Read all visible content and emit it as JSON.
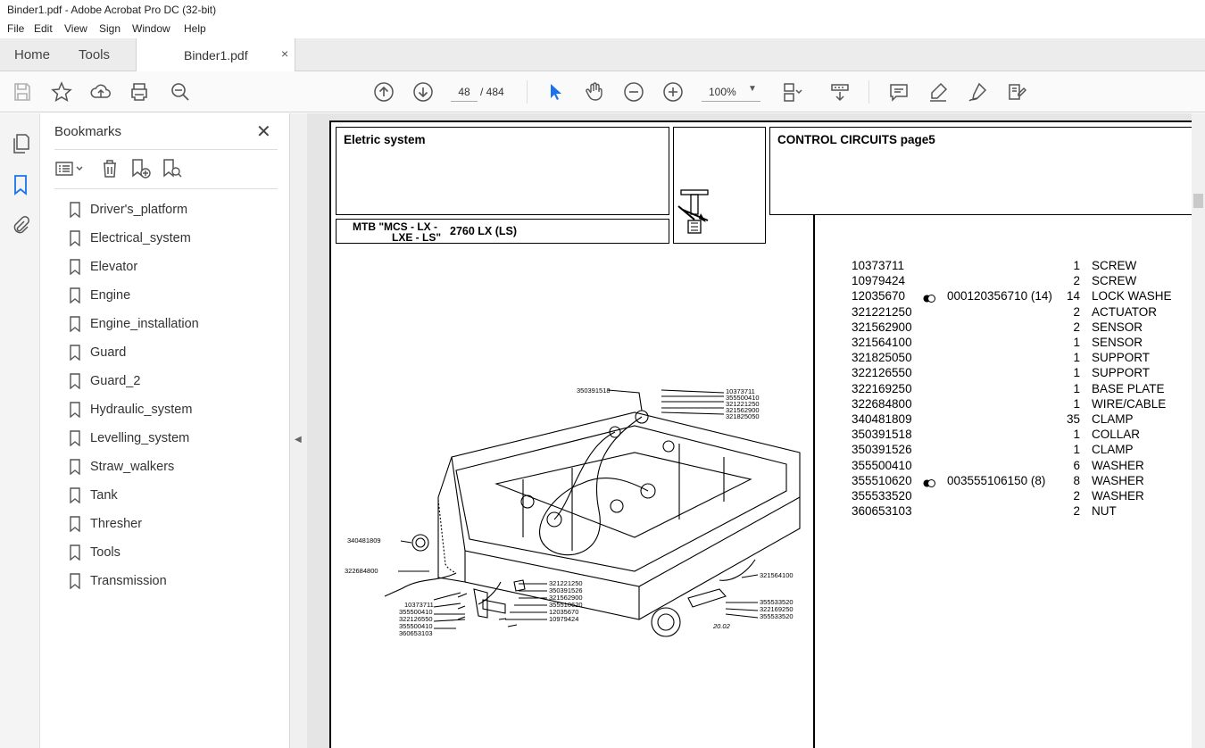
{
  "window": {
    "title": "Binder1.pdf - Adobe Acrobat Pro DC (32-bit)"
  },
  "menu": [
    "File",
    "Edit",
    "View",
    "Sign",
    "Window",
    "Help"
  ],
  "tabs": {
    "home": "Home",
    "tools": "Tools",
    "document": "Binder1.pdf",
    "close": "×"
  },
  "toolbar": {
    "current_page": "48",
    "page_total": "/ 484",
    "zoom": "100%",
    "icons": [
      "save-icon",
      "star-icon",
      "upload-icon",
      "print-icon",
      "zoom-search-icon",
      "arrow-up-icon",
      "arrow-down-icon",
      "select-cursor-icon",
      "hand-icon",
      "zoom-out-icon",
      "zoom-in-icon",
      "page-layout-icon",
      "scroll-mode-icon",
      "comment-icon",
      "highlight-icon",
      "draw-icon",
      "fill-sign-icon"
    ]
  },
  "bookmarks": {
    "title": "Bookmarks",
    "close": "✕",
    "items": [
      "Driver's_platform",
      "Electrical_system",
      "Elevator",
      "Engine",
      "Engine_installation",
      "Guard",
      "Guard_2",
      "Hydraulic_system",
      "Levelling_system",
      "Straw_walkers",
      "Tank",
      "Thresher",
      "Tools",
      "Transmission"
    ]
  },
  "document": {
    "section_title": "Eletric system",
    "model_line1": "MTB \"MCS - LX -",
    "model_line2": "LXE - LS\"",
    "model_code": "2760 LX (LS)",
    "page_title": "CONTROL CIRCUITS  page5",
    "parts": [
      {
        "code": "10373711",
        "alt": "",
        "qty": "1",
        "desc": "SCREW"
      },
      {
        "code": "10979424",
        "alt": "",
        "qty": "2",
        "desc": "SCREW"
      },
      {
        "code": "12035670",
        "alt": "000120356710  (14)",
        "qty": "14",
        "desc": "LOCK WASHE"
      },
      {
        "code": "321221250",
        "alt": "",
        "qty": "2",
        "desc": "ACTUATOR"
      },
      {
        "code": "321562900",
        "alt": "",
        "qty": "2",
        "desc": "SENSOR"
      },
      {
        "code": "321564100",
        "alt": "",
        "qty": "1",
        "desc": "SENSOR"
      },
      {
        "code": "321825050",
        "alt": "",
        "qty": "1",
        "desc": "SUPPORT"
      },
      {
        "code": "322126550",
        "alt": "",
        "qty": "1",
        "desc": "SUPPORT"
      },
      {
        "code": "322169250",
        "alt": "",
        "qty": "1",
        "desc": "BASE PLATE"
      },
      {
        "code": "322684800",
        "alt": "",
        "qty": "1",
        "desc": "WIRE/CABLE"
      },
      {
        "code": "340481809",
        "alt": "",
        "qty": "35",
        "desc": "CLAMP"
      },
      {
        "code": "350391518",
        "alt": "",
        "qty": "1",
        "desc": "COLLAR"
      },
      {
        "code": "350391526",
        "alt": "",
        "qty": "1",
        "desc": "CLAMP"
      },
      {
        "code": "355500410",
        "alt": "",
        "qty": "6",
        "desc": "WASHER"
      },
      {
        "code": "355510620",
        "alt": "003555106150  (8)",
        "qty": "8",
        "desc": "WASHER"
      },
      {
        "code": "355533520",
        "alt": "",
        "qty": "2",
        "desc": "WASHER"
      },
      {
        "code": "360653103",
        "alt": "",
        "qty": "2",
        "desc": "NUT"
      }
    ],
    "diagram_labels": {
      "top_left": "350391518",
      "top_right": [
        "10373711",
        "355500410",
        "321221250",
        "321562900",
        "321825050"
      ],
      "left": [
        "340481809",
        "322684800"
      ],
      "bottom_left": [
        "10373711",
        "355500410",
        "322126550",
        "355500410",
        "360653103"
      ],
      "bottom_mid": [
        "321221250",
        "350391526",
        "321562900",
        "355510620",
        "12035670",
        "10979424"
      ],
      "right": [
        "321564100",
        "355533520",
        "322169250",
        "355533520"
      ],
      "figure_no": "20.02"
    }
  }
}
